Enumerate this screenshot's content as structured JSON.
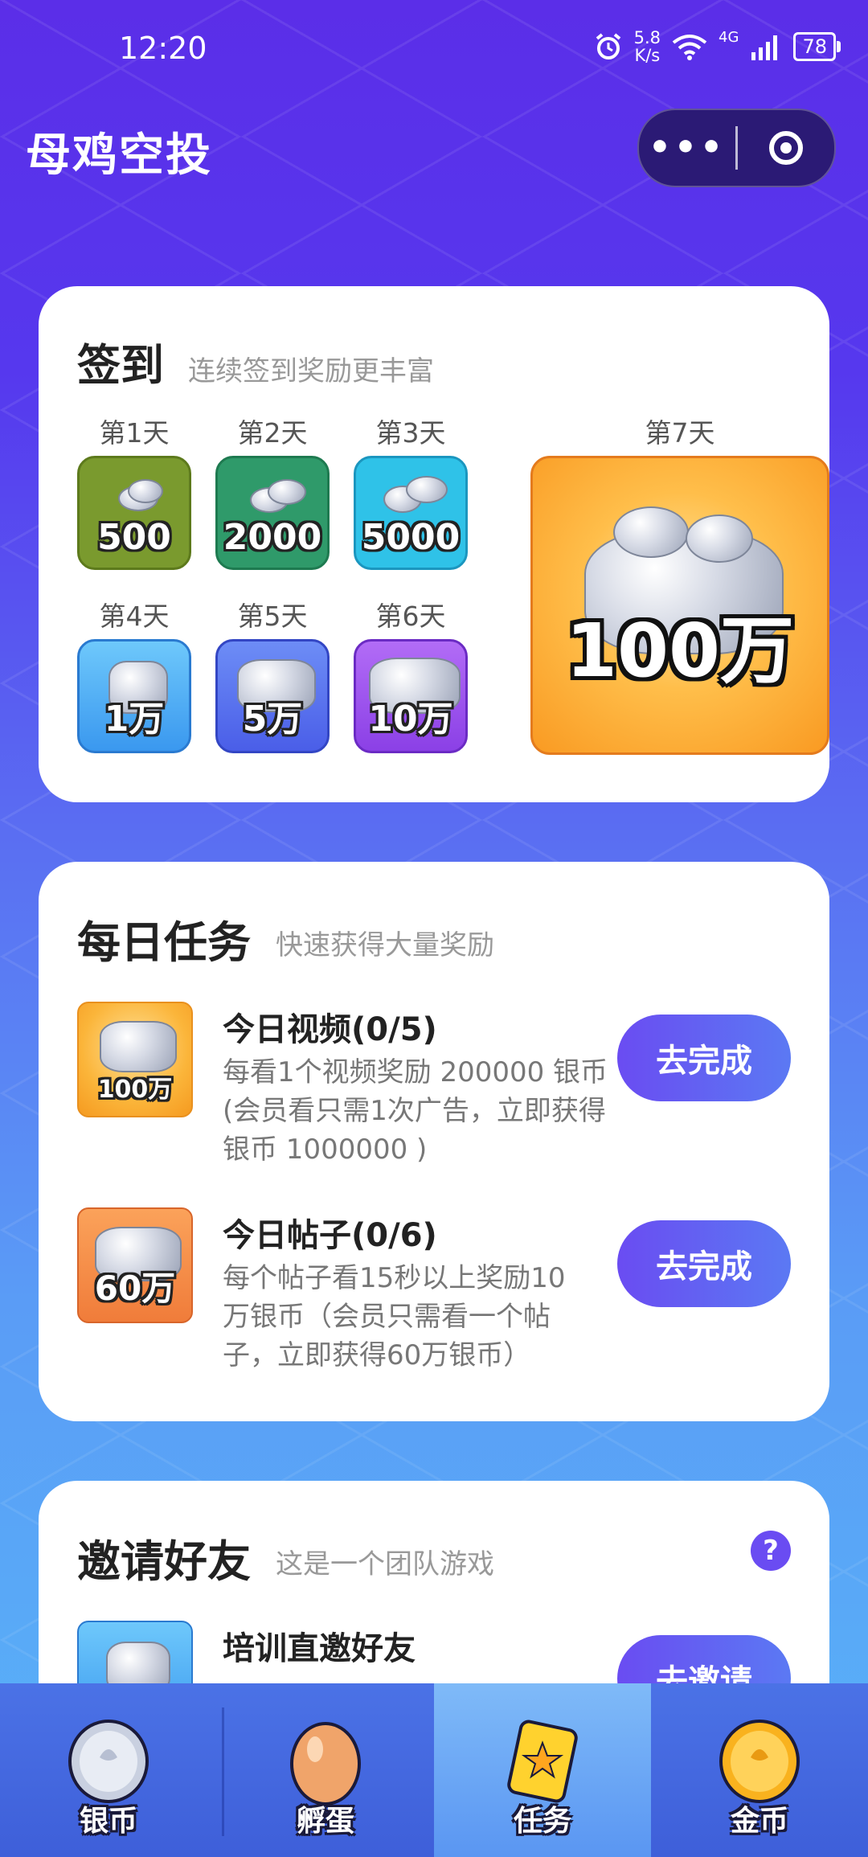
{
  "status_bar": {
    "time": "12:20",
    "net_speed_value": "5.8",
    "net_speed_unit": "K/s",
    "network_type": "4G",
    "battery": "78"
  },
  "header": {
    "title": "母鸡空投",
    "more_label": "•••"
  },
  "signin": {
    "title": "签到",
    "subtitle": "连续签到奖励更丰富",
    "days": [
      {
        "label": "第1天",
        "amount": "500",
        "color": "#7a9a2e"
      },
      {
        "label": "第2天",
        "amount": "2000",
        "color": "#2f9a6a"
      },
      {
        "label": "第3天",
        "amount": "5000",
        "color": "#2fc2e8"
      },
      {
        "label": "第4天",
        "amount": "1万",
        "color": "#3aa2f2"
      },
      {
        "label": "第5天",
        "amount": "5万",
        "color": "#4a6ef0"
      },
      {
        "label": "第6天",
        "amount": "10万",
        "color": "#9a4ef0"
      },
      {
        "label": "第7天",
        "amount": "100万",
        "color": "#f9a22a"
      }
    ]
  },
  "daily_tasks": {
    "title": "每日任务",
    "subtitle": "快速获得大量奖励",
    "items": [
      {
        "thumb_amount": "100万",
        "title": "今日视频(0/5)",
        "desc": "每看1个视频奖励 200000 银币(会员看只需1次广告，立即获得银币 1000000 )",
        "button": "去完成"
      },
      {
        "thumb_amount": "60万",
        "title": "今日帖子(0/6)",
        "desc": "每个帖子看15秒以上奖励10万银币（会员只需看一个帖子，立即获得60万银币）",
        "button": "去完成"
      }
    ]
  },
  "invite": {
    "title": "邀请好友",
    "subtitle": "这是一个团队游戏",
    "help": "?",
    "item_title": "培训直邀好友",
    "button": "去邀请"
  },
  "bottom_nav": {
    "items": [
      {
        "label": "银币"
      },
      {
        "label": "孵蛋"
      },
      {
        "label": "任务"
      },
      {
        "label": "金币"
      }
    ],
    "active_index": 2
  }
}
